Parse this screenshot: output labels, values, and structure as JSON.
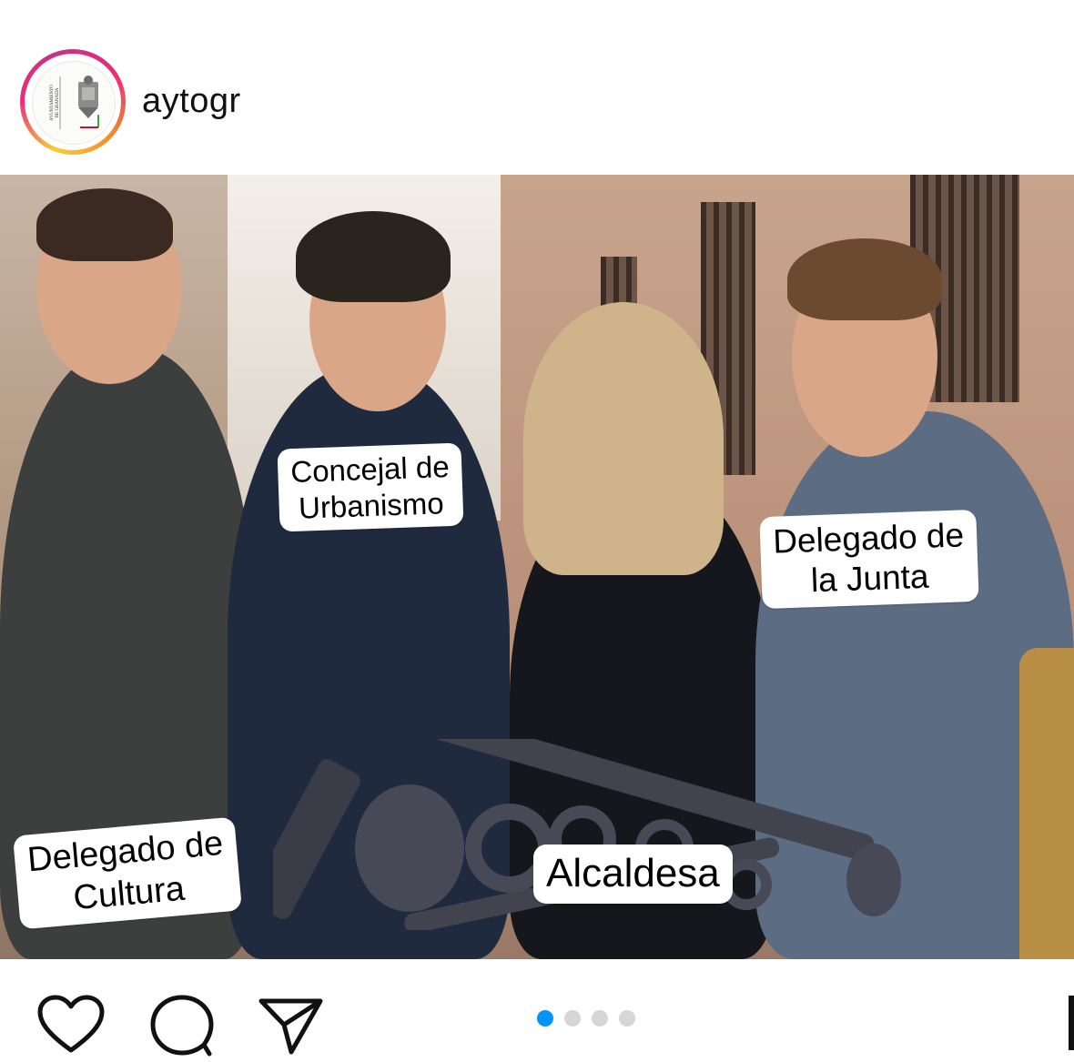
{
  "header": {
    "username": "aytogr",
    "avatar_icon": "ayuntamiento-de-granada-logo",
    "avatar_logo_text": "AYUNTAMIENTO DE GRANADA"
  },
  "post": {
    "labels": [
      "Concejal de Urbanismo",
      "Delegado de la Junta",
      "Delegado de Cultura",
      "Alcaldesa"
    ]
  },
  "actions": {
    "like_icon": "heart-icon",
    "comment_icon": "comment-icon",
    "share_icon": "send-icon"
  },
  "carousel": {
    "total_slides": 4,
    "current_slide": 1,
    "active_color": "#0095f6",
    "inactive_color": "#d6d6d6"
  },
  "colors": {
    "story_ring": [
      "#f9ce34",
      "#ee2a7b",
      "#c13584"
    ],
    "background": "#ffffff",
    "text": "#111111"
  }
}
